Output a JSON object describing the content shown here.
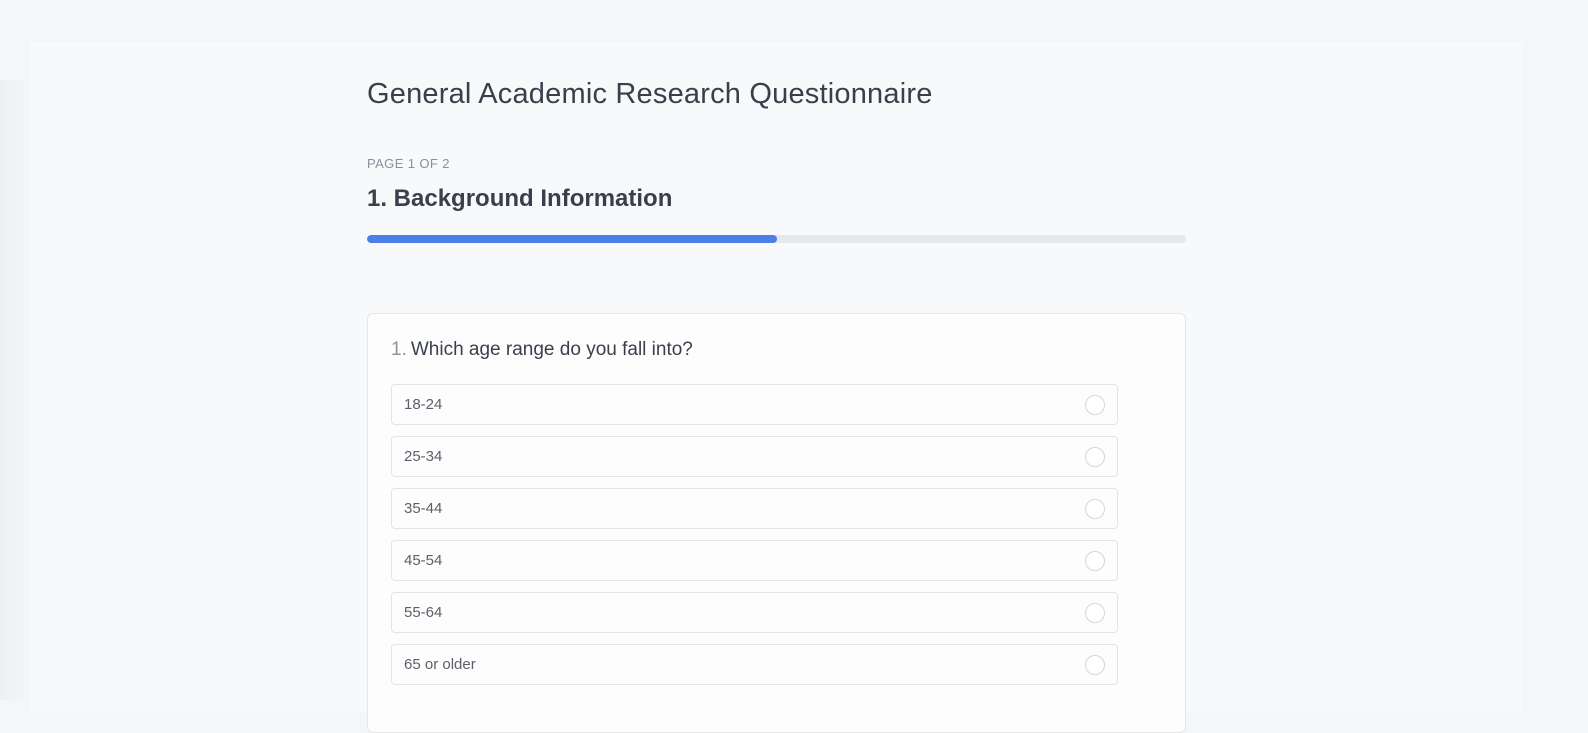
{
  "survey": {
    "title": "General Academic Research Questionnaire",
    "page_indicator": "PAGE 1 OF 2",
    "page_heading": "1. Background Information",
    "progress_fraction": 0.5
  },
  "question": {
    "number": "1.",
    "text": "Which age range do you fall into?",
    "options": [
      {
        "label": "18-24",
        "selected": false
      },
      {
        "label": "25-34",
        "selected": false
      },
      {
        "label": "35-44",
        "selected": false
      },
      {
        "label": "45-54",
        "selected": false
      },
      {
        "label": "55-64",
        "selected": false
      },
      {
        "label": "65 or older",
        "selected": false
      }
    ]
  },
  "colors": {
    "accent": "#4a80e8",
    "progress_track": "#e6e8ec",
    "page_background": "#f5f6f8"
  }
}
